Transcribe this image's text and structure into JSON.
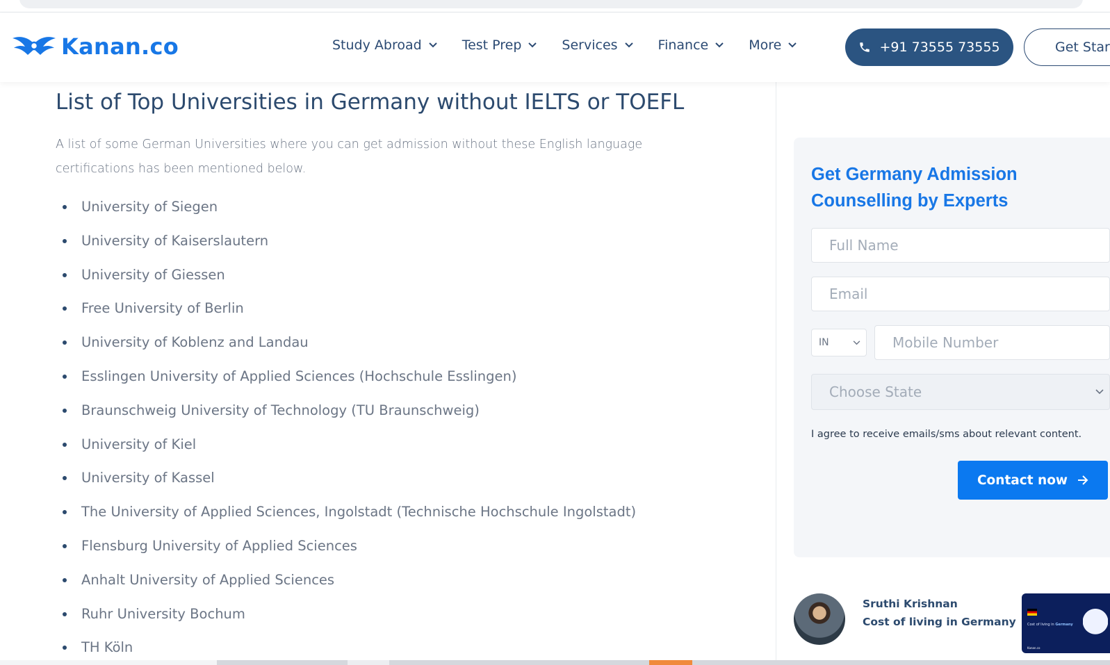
{
  "header": {
    "logo_text": "Kanan.co",
    "nav": [
      {
        "label": "Study Abroad"
      },
      {
        "label": "Test Prep"
      },
      {
        "label": "Services"
      },
      {
        "label": "Finance"
      },
      {
        "label": "More"
      }
    ],
    "phone_label": "+91 73555 73555",
    "get_started_label": "Get Start"
  },
  "main": {
    "heading": "List of Top Universities in Germany without IELTS or TOEFL",
    "intro": "A list of some German Universities where you can get admission without these English language certifications has been mentioned below.",
    "universities": [
      "University of Siegen",
      "University of Kaiserslautern",
      "University of Giessen",
      "Free University of Berlin",
      "University of Koblenz and Landau",
      "Esslingen University of Applied Sciences (Hochschule Esslingen)",
      "Braunschweig University of Technology (TU Braunschweig)",
      "University of Kiel",
      "University of Kassel",
      "The University of Applied Sciences, Ingolstadt (Technische Hochschule Ingolstadt)",
      "Flensburg University of Applied Sciences",
      "Anhalt University of Applied Sciences",
      "Ruhr University Bochum",
      "TH Köln"
    ]
  },
  "form": {
    "title": "Get Germany Admission Counselling by Experts",
    "name_placeholder": "Full Name",
    "email_placeholder": "Email",
    "country_code": "IN",
    "mobile_placeholder": "Mobile Number",
    "state_placeholder": "Choose State",
    "consent": "I agree to receive emails/sms about relevant content.",
    "submit_label": "Contact now"
  },
  "author": {
    "name": "Sruthi Krishnan",
    "article_title": "Cost of living in Germany",
    "thumb_text_a": "Cost of living in ",
    "thumb_text_b": "Germany",
    "thumb_logo": "Kanan.co"
  },
  "colors": {
    "brand_blue": "#1877e6",
    "navy": "#2b5481",
    "cta_blue": "#0b79f0"
  }
}
